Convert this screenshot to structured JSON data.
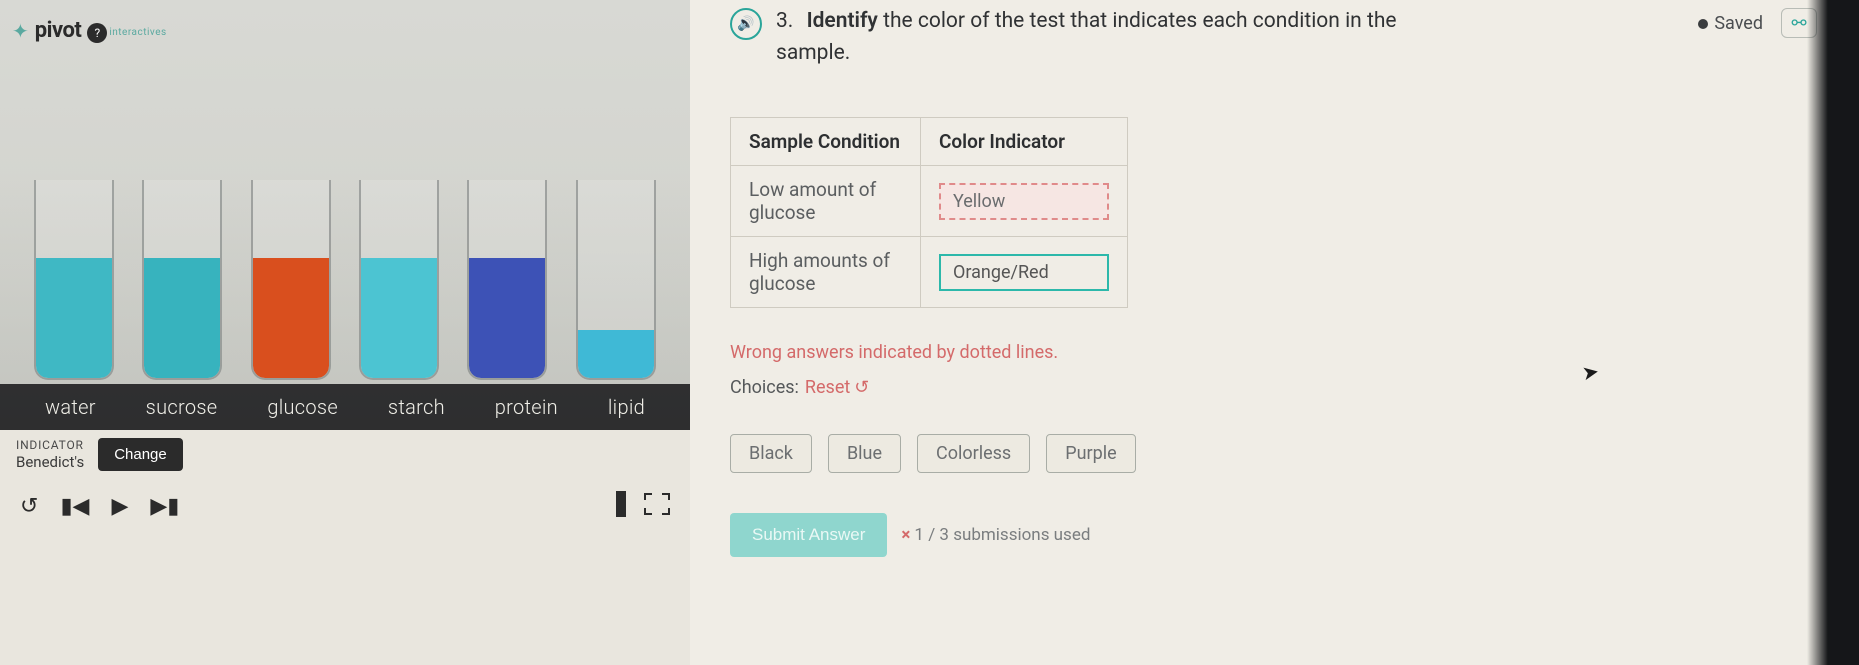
{
  "logo": {
    "brand": "pivot",
    "sub": "interactives",
    "help": "?"
  },
  "video": {
    "tube_labels": [
      "water",
      "sucrose",
      "glucose",
      "starch",
      "protein",
      "lipid"
    ],
    "indicator_label": "INDICATOR",
    "indicator_name": "Benedict's",
    "change_btn": "Change"
  },
  "question": {
    "number": "3.",
    "bold": "Identify",
    "rest": " the color of the test that indicates each condition in the sample."
  },
  "saved": {
    "label": "Saved"
  },
  "table": {
    "headers": [
      "Sample Condition",
      "Color Indicator"
    ],
    "rows": [
      {
        "condition": "Low amount of glucose",
        "answer": "Yellow"
      },
      {
        "condition": "High amounts of glucose",
        "answer": "Orange/Red"
      }
    ]
  },
  "hints": {
    "wrong": "Wrong answers indicated by dotted lines.",
    "choices_label": "Choices:",
    "reset": "Reset"
  },
  "chips": [
    "Black",
    "Blue",
    "Colorless",
    "Purple"
  ],
  "submit": {
    "button": "Submit Answer",
    "x": "×",
    "count": "1 / 3 submissions used"
  }
}
